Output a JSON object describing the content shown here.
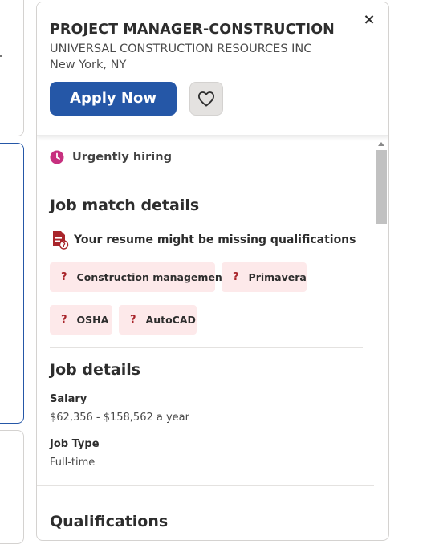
{
  "header": {
    "job_title": "PROJECT MANAGER-CONSTRUCTION",
    "company": "UNIVERSAL CONSTRUCTION RESOURCES INC",
    "location": "New York, NY",
    "apply_label": "Apply Now",
    "close_glyph": "×"
  },
  "urgent": {
    "label": "Urgently hiring"
  },
  "job_match": {
    "heading": "Job match details",
    "missing_label": "Your resume might be missing qualifications",
    "qualifications": [
      "Construction management",
      "Primavera",
      "OSHA",
      "AutoCAD"
    ],
    "chip_marker": "?"
  },
  "job_details": {
    "heading": "Job details",
    "salary_label": "Salary",
    "salary_value": "$62,356 - $158,562 a year",
    "job_type_label": "Job Type",
    "job_type_value": "Full-time"
  },
  "qualifications_section": {
    "heading": "Qualifications"
  },
  "colors": {
    "apply_button": "#2557a7",
    "chip_bg": "#fde9ea",
    "chip_marker": "#a9252b",
    "urgent_icon": "#c7307f"
  },
  "icons": [
    "close-icon",
    "heart-icon",
    "clock-icon",
    "document-question-icon"
  ]
}
